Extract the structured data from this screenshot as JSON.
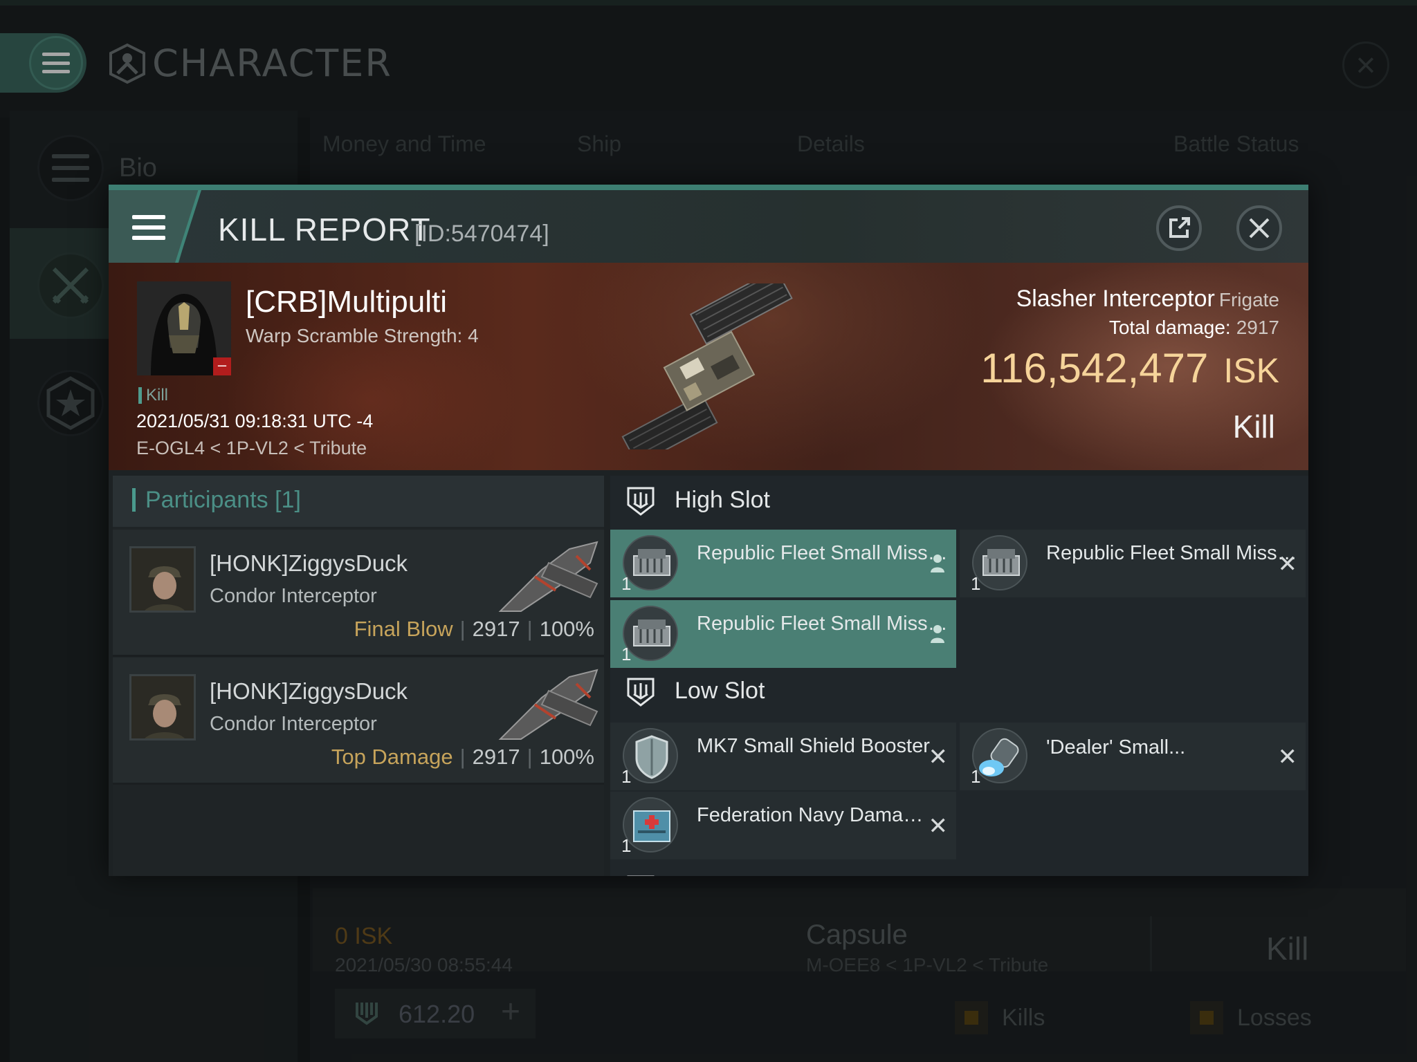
{
  "app": {
    "title": "CHARACTER",
    "sidebar": [
      {
        "label": "Bio",
        "icon": "menu-icon"
      },
      {
        "label": "",
        "icon": "crossed-swords-icon"
      },
      {
        "label": "",
        "icon": "star-badge-icon"
      }
    ],
    "tabs": [
      "Money and Time",
      "Ship",
      "Details",
      "Battle Status"
    ],
    "background_entry": {
      "isk": "0  ISK",
      "date": "2021/05/30  08:55:44",
      "ship": "Capsule",
      "location": "M-OEE8 < 1P-VL2 < Tribute",
      "result": "Kill"
    },
    "footer": {
      "value": "612.20",
      "plus": "+",
      "legend_kills": "Kills",
      "legend_losses": "Losses"
    }
  },
  "modal": {
    "title": "KILL REPORT",
    "id": "[ID:5470474]",
    "export_icon": "external-link-icon",
    "close_icon": "close-icon",
    "victim": {
      "name": "[CRB]Multipulti",
      "subtitle": "Warp Scramble Strength: 4",
      "tag": "Kill",
      "datetime": "2021/05/31 09:18:31 UTC -4",
      "location": "E-OGL4 < 1P-VL2 < Tribute"
    },
    "summary": {
      "ship": "Slasher Interceptor",
      "ship_class": "Frigate",
      "damage_label": "Total damage:",
      "damage_value": "2917",
      "isk_value": "116,542,477",
      "isk_unit": "ISK",
      "result": "Kill"
    },
    "participants": {
      "label": "Participants [1]",
      "rows": [
        {
          "name": "[HONK]ZiggysDuck",
          "ship": "Condor Interceptor",
          "tag": "Final Blow",
          "damage": "2917",
          "percent": "100%"
        },
        {
          "name": "[HONK]ZiggysDuck",
          "ship": "Condor Interceptor",
          "tag": "Top Damage",
          "damage": "2917",
          "percent": "100%"
        }
      ]
    },
    "fitting": {
      "high_slot_label": "High Slot",
      "low_slot_label": "Low Slot",
      "high": [
        {
          "name": "Republic Fleet Small Missile Launcher",
          "qty": "1",
          "status": "dropped"
        },
        {
          "name": "Republic Fleet Small Missile ...",
          "qty": "1",
          "status": "destroyed"
        },
        {
          "name": "Republic Fleet Small Missile Launcher",
          "qty": "1",
          "status": "dropped"
        }
      ],
      "low": [
        {
          "name": "MK7 Small Shield Booster",
          "qty": "1",
          "status": "destroyed"
        },
        {
          "name": "'Dealer' Small...",
          "qty": "1",
          "status": "destroyed"
        },
        {
          "name": "Federation Navy Damage...",
          "qty": "1",
          "status": "destroyed"
        }
      ],
      "destroyed_mark": "✕"
    }
  }
}
